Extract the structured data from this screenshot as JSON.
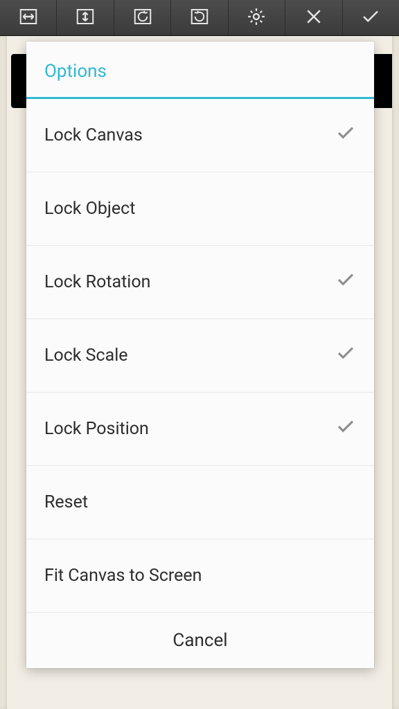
{
  "toolbar": {
    "flip_h_icon": "flip-horizontal-icon",
    "flip_v_icon": "flip-vertical-icon",
    "rotate_ccw_icon": "rotate-ccw-icon",
    "rotate_cw_icon": "rotate-cw-icon",
    "settings_icon": "gear-icon",
    "close_icon": "close-icon",
    "confirm_icon": "check-icon"
  },
  "panel": {
    "title": "Options",
    "items": [
      {
        "label": "Lock Canvas",
        "checked": true
      },
      {
        "label": "Lock Object",
        "checked": false
      },
      {
        "label": "Lock Rotation",
        "checked": true
      },
      {
        "label": "Lock Scale",
        "checked": true
      },
      {
        "label": "Lock Position",
        "checked": true
      },
      {
        "label": "Reset",
        "checked": false
      },
      {
        "label": "Fit Canvas to Screen",
        "checked": false
      }
    ],
    "cancel_label": "Cancel"
  }
}
